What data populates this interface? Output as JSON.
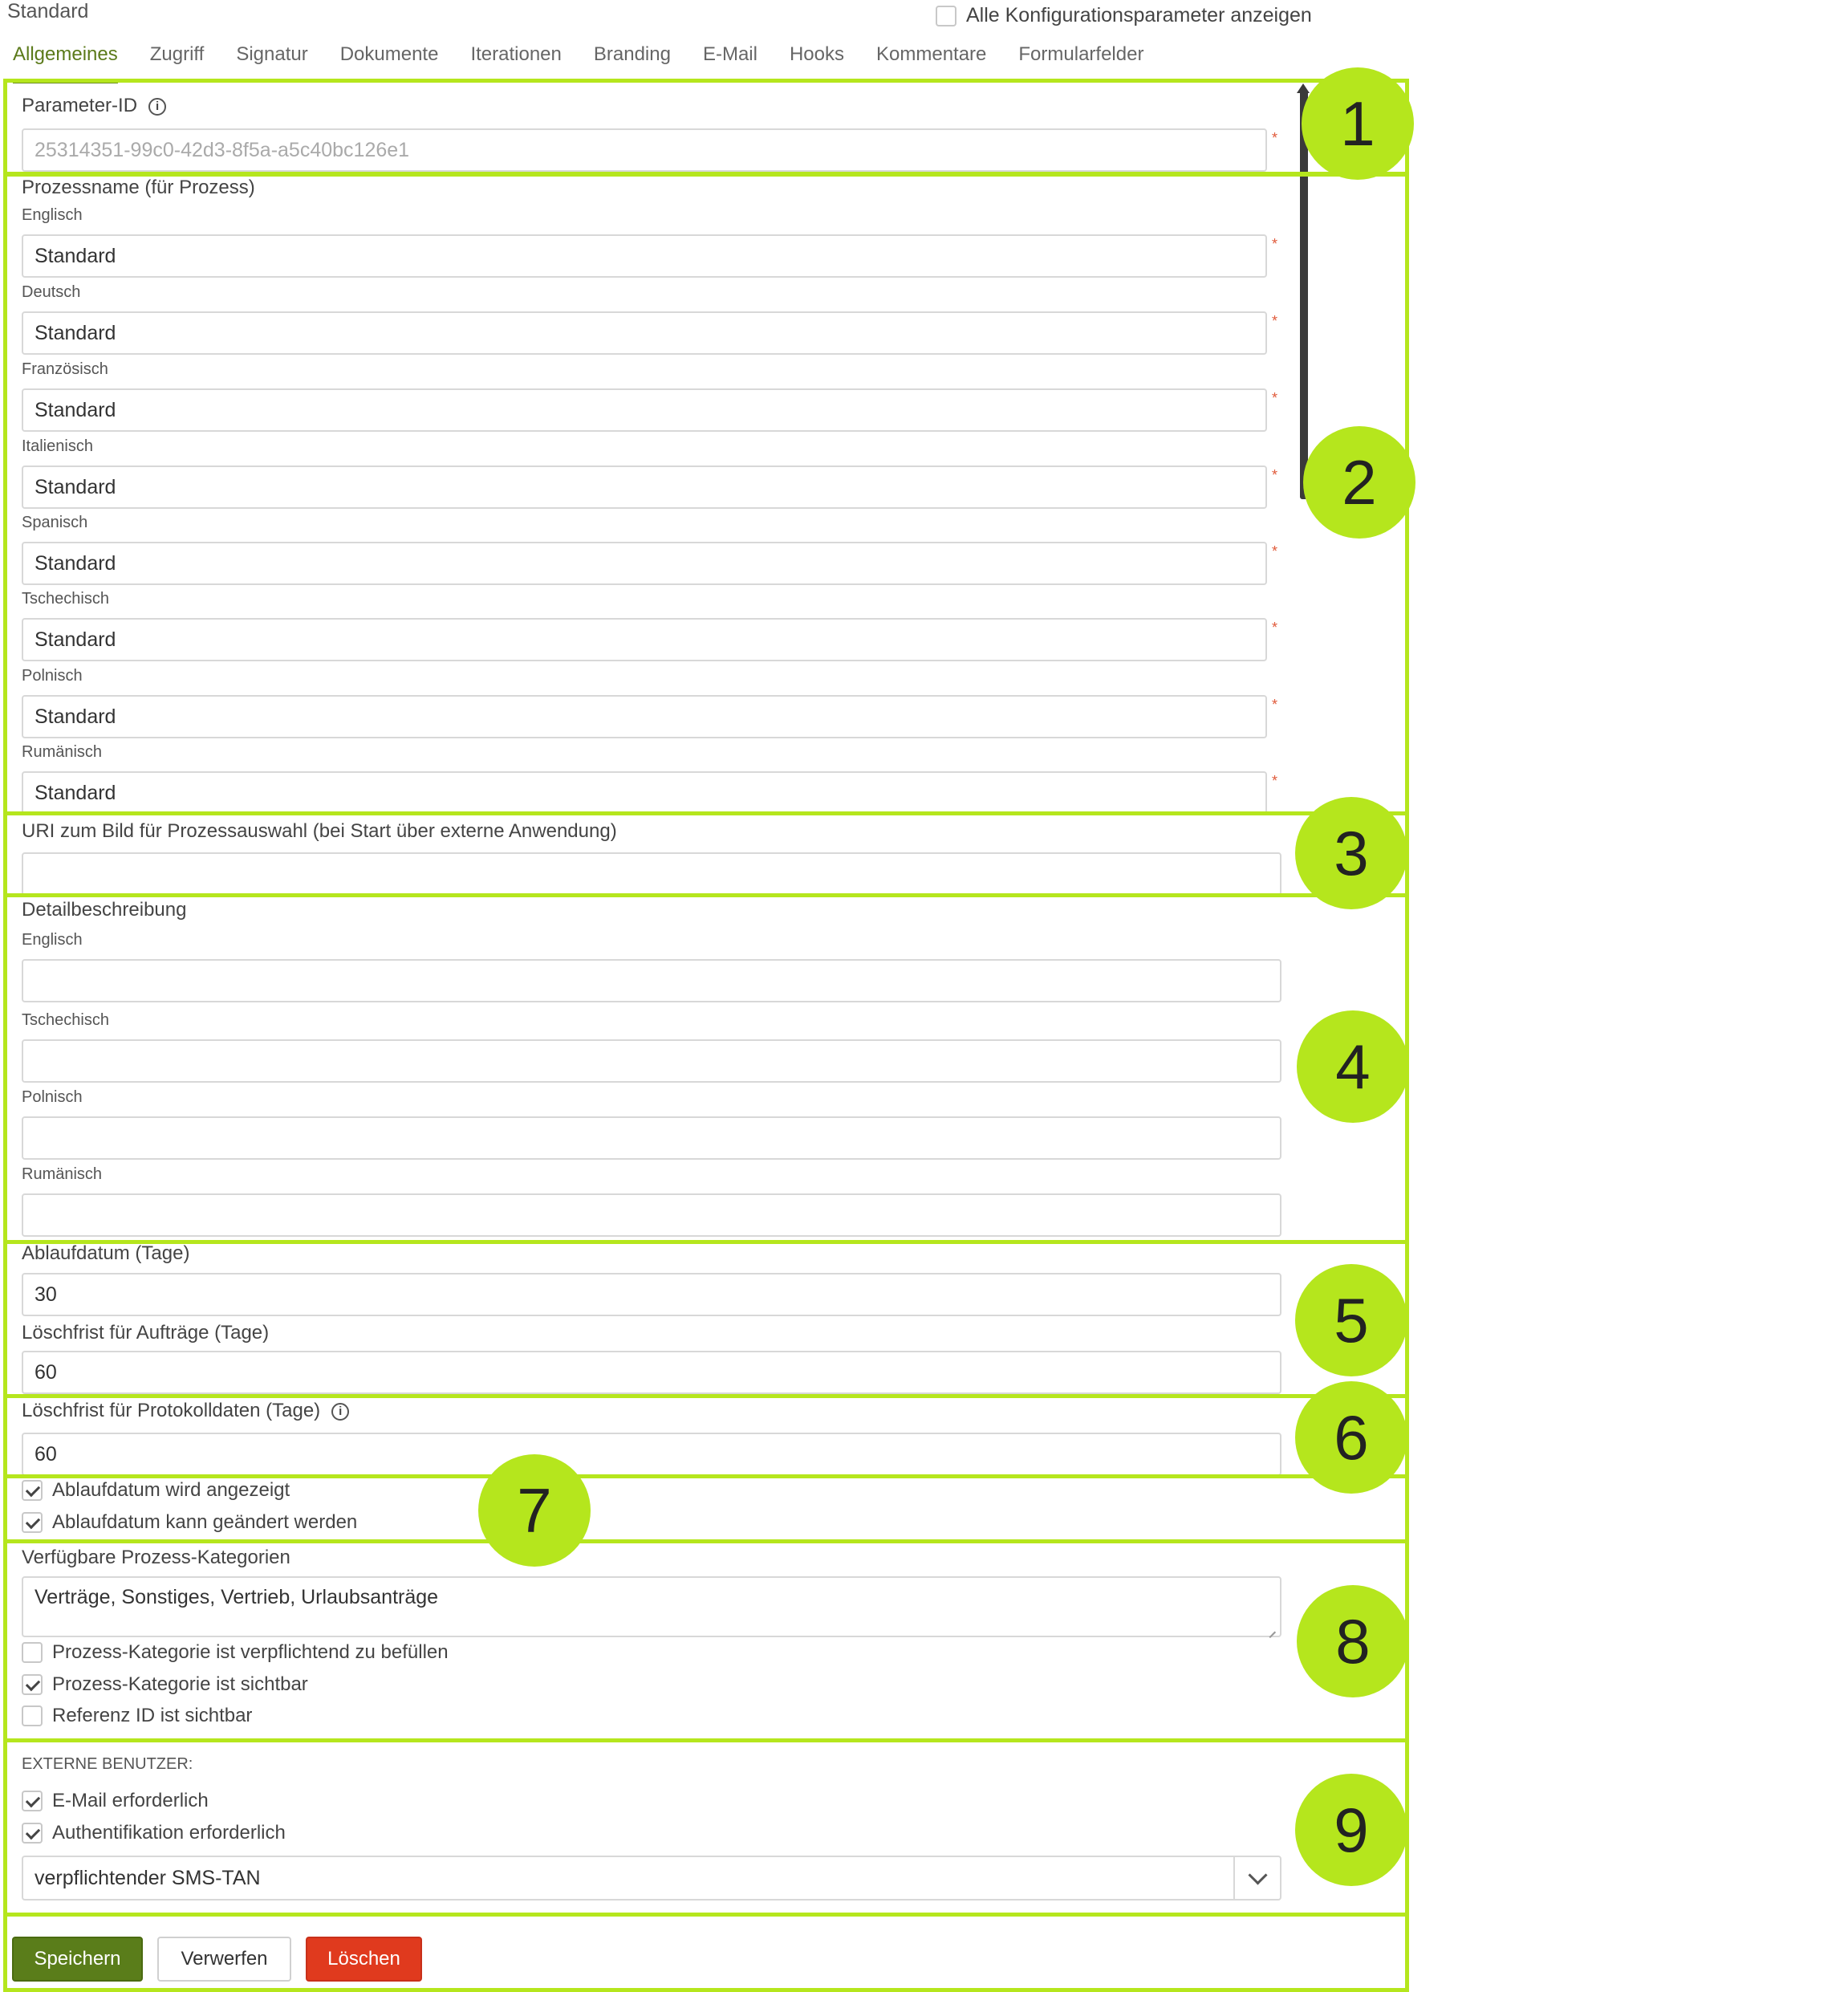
{
  "header": {
    "title": "Standard",
    "show_all_label": "Alle Konfigurationsparameter anzeigen"
  },
  "tabs": [
    {
      "label": "Allgemeines",
      "active": true
    },
    {
      "label": "Zugriff"
    },
    {
      "label": "Signatur"
    },
    {
      "label": "Dokumente"
    },
    {
      "label": "Iterationen"
    },
    {
      "label": "Branding"
    },
    {
      "label": "E-Mail"
    },
    {
      "label": "Hooks"
    },
    {
      "label": "Kommentare"
    },
    {
      "label": "Formularfelder"
    }
  ],
  "parameter_id": {
    "label": "Parameter-ID",
    "value": "25314351-99c0-42d3-8f5a-a5c40bc126e1"
  },
  "process_name": {
    "label": "Prozessname (für Prozess)",
    "languages": [
      {
        "lang": "Englisch",
        "value": "Standard"
      },
      {
        "lang": "Deutsch",
        "value": "Standard"
      },
      {
        "lang": "Französisch",
        "value": "Standard"
      },
      {
        "lang": "Italienisch",
        "value": "Standard"
      },
      {
        "lang": "Spanisch",
        "value": "Standard"
      },
      {
        "lang": "Tschechisch",
        "value": "Standard"
      },
      {
        "lang": "Polnisch",
        "value": "Standard"
      },
      {
        "lang": "Rumänisch",
        "value": "Standard"
      }
    ]
  },
  "uri_image": {
    "label": "URI zum Bild für Prozessauswahl (bei Start über externe Anwendung)",
    "value": ""
  },
  "detail_description": {
    "label": "Detailbeschreibung",
    "languages": [
      {
        "lang": "Englisch",
        "value": ""
      },
      {
        "lang": "Tschechisch",
        "value": ""
      },
      {
        "lang": "Polnisch",
        "value": ""
      },
      {
        "lang": "Rumänisch",
        "value": ""
      }
    ]
  },
  "expiry_days": {
    "label": "Ablaufdatum (Tage)",
    "value": "30"
  },
  "deletion_orders": {
    "label": "Löschfrist für Aufträge (Tage)",
    "value": "60"
  },
  "deletion_logs": {
    "label": "Löschfrist für Protokolldaten (Tage)",
    "value": "60"
  },
  "expiry_checks": [
    {
      "label": "Ablaufdatum wird angezeigt",
      "checked": true
    },
    {
      "label": "Ablaufdatum kann geändert werden",
      "checked": true
    }
  ],
  "categories": {
    "label": "Verfügbare Prozess-Kategorien",
    "value": "Verträge, Sonstiges, Vertrieb, Urlaubsanträge",
    "checks": [
      {
        "label": "Prozess-Kategorie ist verpflichtend zu befüllen",
        "checked": false
      },
      {
        "label": "Prozess-Kategorie ist sichtbar",
        "checked": true
      },
      {
        "label": "Referenz ID ist sichtbar",
        "checked": false
      }
    ]
  },
  "external_users": {
    "label": "EXTERNE BENUTZER:",
    "checks": [
      {
        "label": "E-Mail erforderlich",
        "checked": true
      },
      {
        "label": "Authentifikation erforderlich",
        "checked": true
      }
    ],
    "auth_select": "verpflichtender SMS-TAN"
  },
  "buttons": {
    "save": "Speichern",
    "discard": "Verwerfen",
    "delete": "Löschen"
  },
  "badges": [
    "1",
    "2",
    "3",
    "4",
    "5",
    "6",
    "7",
    "8",
    "9"
  ],
  "colors": {
    "highlight": "#b5e61d",
    "save": "#5a7d1a",
    "delete": "#e03a1e",
    "tab_active": "#5b7a1a"
  }
}
